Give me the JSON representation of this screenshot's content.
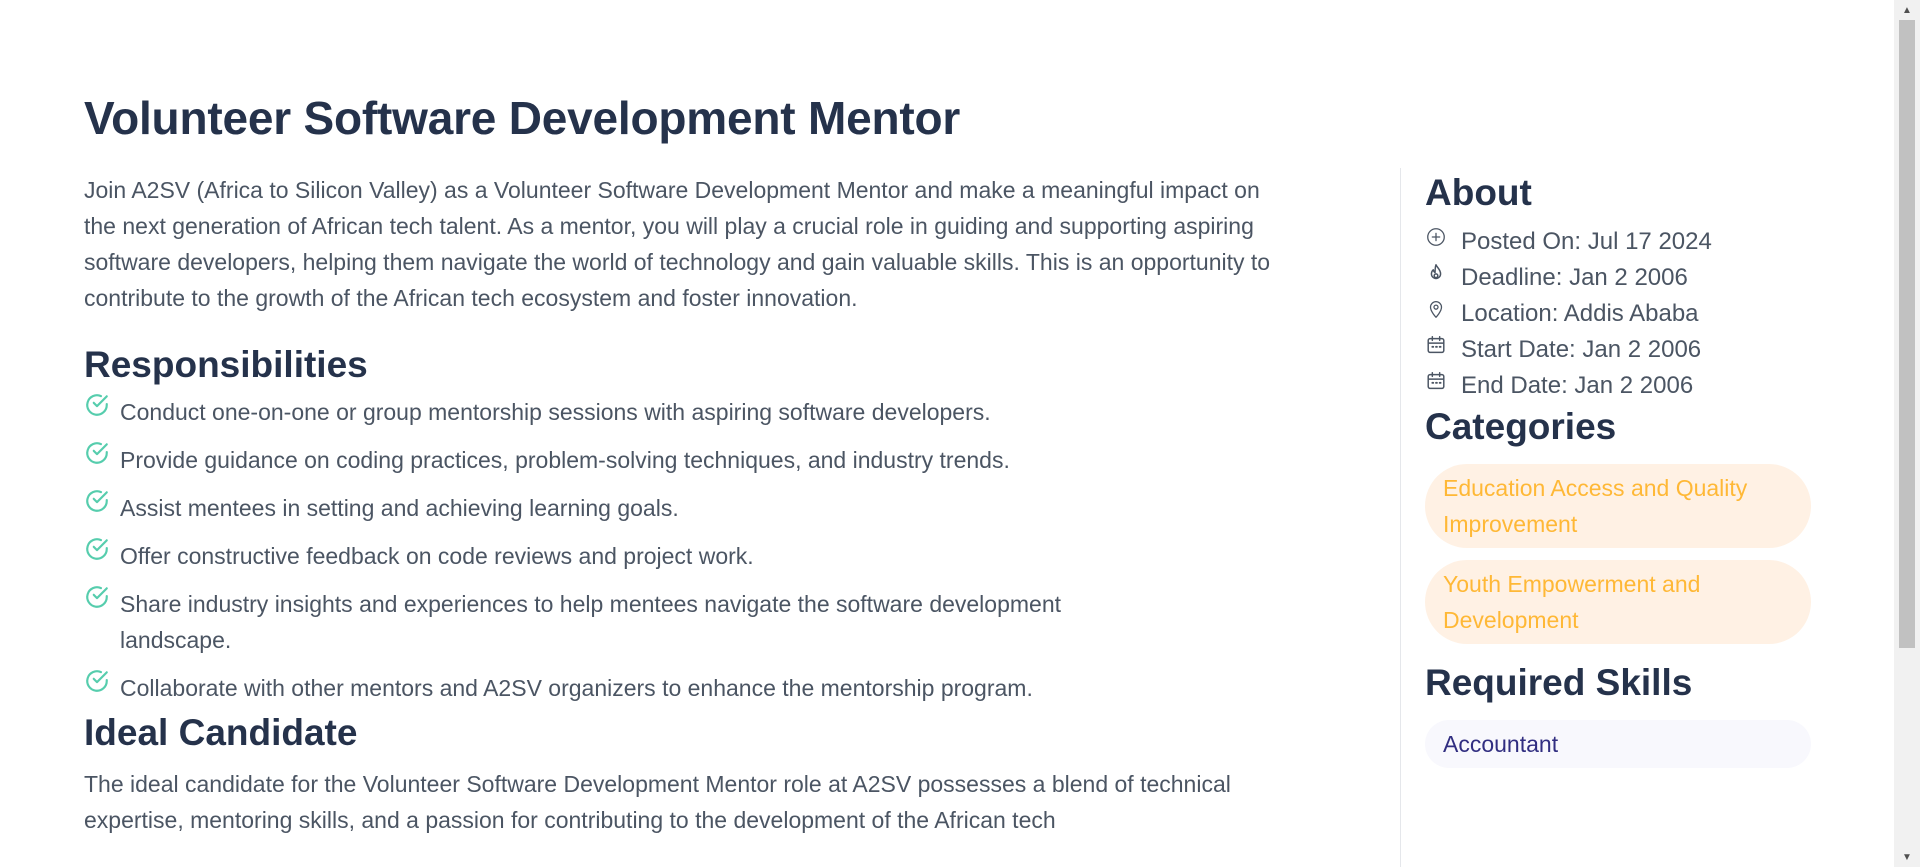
{
  "job": {
    "title": "Volunteer Software Development Mentor",
    "description": "Join A2SV (Africa to Silicon Valley) as a Volunteer Software Development Mentor and make a meaningful impact on the next generation of African tech talent. As a mentor, you will play a crucial role in guiding and supporting aspiring software developers, helping them navigate the world of technology and gain valuable skills. This is an opportunity to contribute to the growth of the African tech ecosystem and foster innovation."
  },
  "responsibilities": {
    "heading": "Responsibilities",
    "items": [
      "Conduct one-on-one or group mentorship sessions with aspiring software developers.",
      "Provide guidance on coding practices, problem-solving techniques, and industry trends.",
      "Assist mentees in setting and achieving learning goals.",
      "Offer constructive feedback on code reviews and project work.",
      "Share industry insights and experiences to help mentees navigate the software development landscape.",
      "Collaborate with other mentors and A2SV organizers to enhance the mentorship program."
    ]
  },
  "ideal_candidate": {
    "heading": "Ideal Candidate",
    "text": "The ideal candidate for the Volunteer Software Development Mentor role at A2SV possesses a blend of technical expertise, mentoring skills, and a passion for contributing to the development of the African tech"
  },
  "about": {
    "heading": "About",
    "items": [
      {
        "icon": "plus-circle-icon",
        "label": "Posted On: Jul 17 2024"
      },
      {
        "icon": "fire-icon",
        "label": "Deadline: Jan 2 2006"
      },
      {
        "icon": "location-pin-icon",
        "label": "Location: Addis Ababa"
      },
      {
        "icon": "calendar-icon",
        "label": "Start Date: Jan 2 2006"
      },
      {
        "icon": "calendar-icon",
        "label": "End Date: Jan 2 2006"
      }
    ]
  },
  "categories": {
    "heading": "Categories",
    "items": [
      "Education Access and Quality Improvement",
      "Youth Empowerment and Development"
    ]
  },
  "skills": {
    "heading": "Required Skills",
    "items": [
      "Accountant"
    ]
  },
  "colors": {
    "heading": "#25324b",
    "body_text": "#4b5563",
    "check_accent": "#56cdad",
    "category_bg": "#fff1e4",
    "category_text": "#ffb836",
    "skill_bg": "#f8f8fd",
    "skill_text": "#312e81"
  }
}
